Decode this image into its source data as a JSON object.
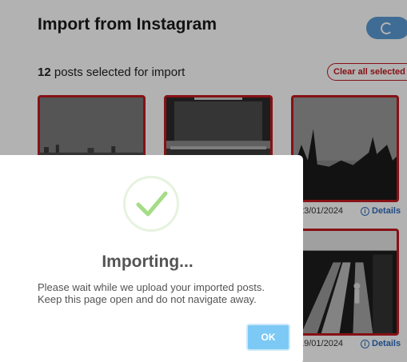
{
  "page": {
    "title": "Import from Instagram",
    "selected_count": "12",
    "selected_text": "posts selected for import",
    "clear_label": "Clear all selected"
  },
  "posts": [
    {
      "date": "",
      "details": ""
    },
    {
      "date": "",
      "details": ""
    },
    {
      "date": "23/01/2024",
      "details": "Details"
    },
    {
      "date": "",
      "details": ""
    },
    {
      "date": "",
      "details": ""
    },
    {
      "date": "19/01/2024",
      "details": "Details"
    }
  ],
  "modal": {
    "title": "Importing...",
    "line1": "Please wait while we upload your imported posts.",
    "line2": "Keep this page open and do not navigate away.",
    "ok_label": "OK"
  },
  "colors": {
    "accent_red": "#c0191f",
    "link_blue": "#2f6ebd",
    "ok_blue": "#7cc9f5",
    "check_green": "#a5dc86"
  },
  "icons": {
    "sync": "spinner-icon",
    "success": "checkmark-icon",
    "info": "info-icon"
  }
}
